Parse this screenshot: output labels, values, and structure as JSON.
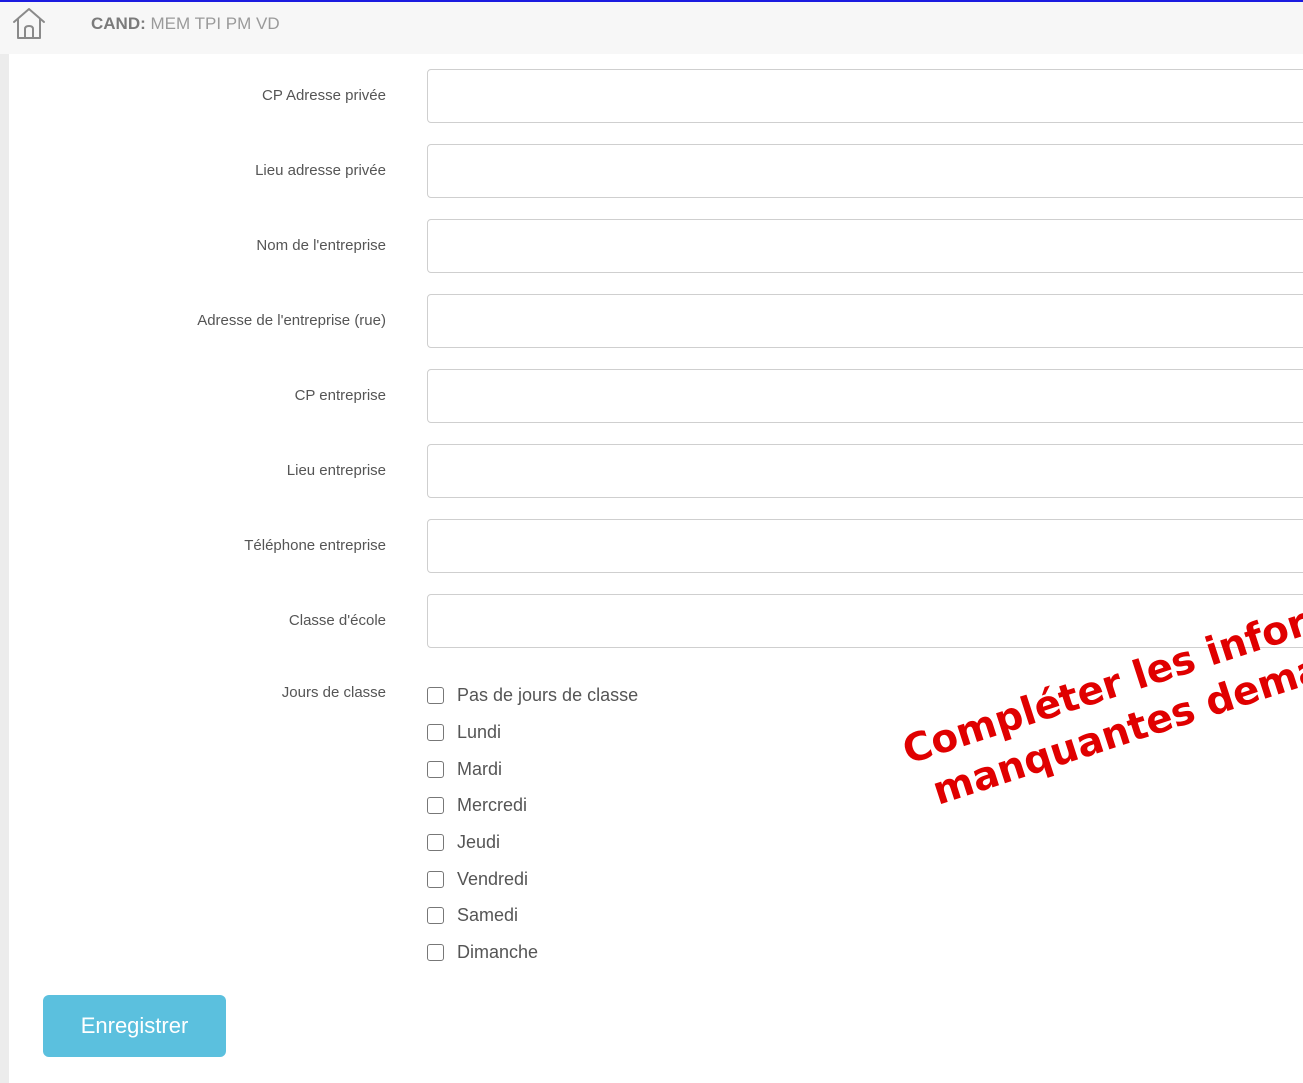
{
  "header": {
    "title_prefix": "CAND:",
    "title": "MEM TPI PM VD"
  },
  "form": {
    "fields": [
      {
        "label": "CP Adresse privée",
        "value": ""
      },
      {
        "label": "Lieu adresse privée",
        "value": ""
      },
      {
        "label": "Nom de l'entreprise",
        "value": ""
      },
      {
        "label": "Adresse de l'entreprise (rue)",
        "value": ""
      },
      {
        "label": "CP entreprise",
        "value": ""
      },
      {
        "label": "Lieu entreprise",
        "value": ""
      },
      {
        "label": "Téléphone entreprise",
        "value": ""
      },
      {
        "label": "Classe d'école",
        "value": ""
      }
    ],
    "days_label": "Jours de classe",
    "days": [
      {
        "label": "Pas de jours de classe",
        "checked": false
      },
      {
        "label": "Lundi",
        "checked": false
      },
      {
        "label": "Mardi",
        "checked": false
      },
      {
        "label": "Mercredi",
        "checked": false
      },
      {
        "label": "Jeudi",
        "checked": false
      },
      {
        "label": "Vendredi",
        "checked": false
      },
      {
        "label": "Samedi",
        "checked": false
      },
      {
        "label": "Dimanche",
        "checked": false
      }
    ],
    "save_label": "Enregistrer"
  },
  "annotation": {
    "line1": "Compléter les informati",
    "line2": "manquantes demandé"
  },
  "colors": {
    "top_border": "#1b1be0",
    "button": "#5bc0de",
    "annotation": "#e00000"
  },
  "icons": {
    "home": "home-icon"
  }
}
